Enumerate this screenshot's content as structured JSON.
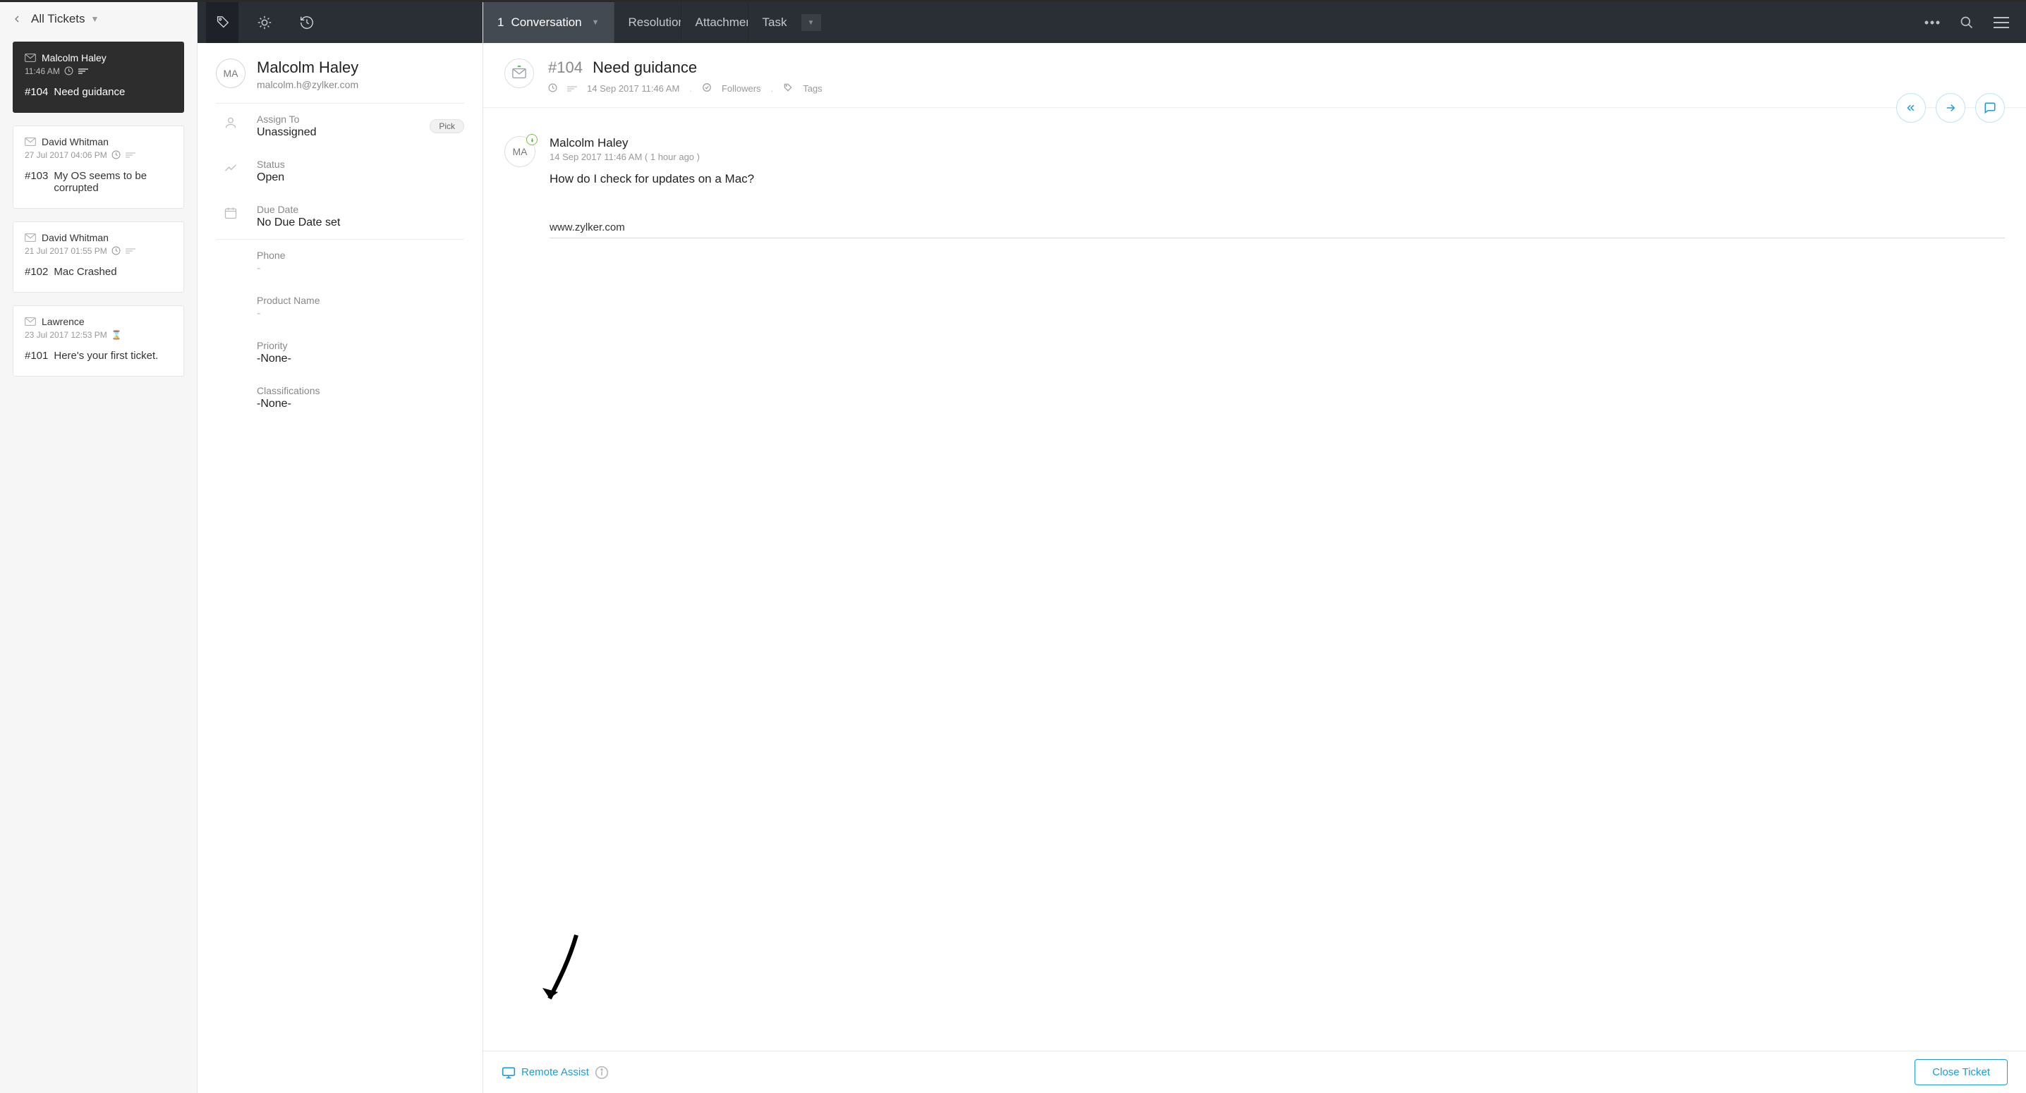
{
  "left": {
    "title": "All Tickets",
    "tickets": [
      {
        "sender": "Malcolm Haley",
        "time": "11:46 AM",
        "num": "#104",
        "title": "Need guidance"
      },
      {
        "sender": "David Whitman",
        "time": "27 Jul 2017 04:06 PM",
        "num": "#103",
        "title": "My OS seems to be corrupted"
      },
      {
        "sender": "David Whitman",
        "time": "21 Jul 2017 01:55 PM",
        "num": "#102",
        "title": "Mac Crashed"
      },
      {
        "sender": "Lawrence",
        "time": "23 Jul 2017 12:53 PM",
        "num": "#101",
        "title": "Here's your first ticket."
      }
    ]
  },
  "contact": {
    "initials": "MA",
    "name": "Malcolm Haley",
    "email": "malcolm.h@zylker.com"
  },
  "props": {
    "assign_label": "Assign To",
    "assign_value": "Unassigned",
    "pick": "Pick",
    "status_label": "Status",
    "status_value": "Open",
    "due_label": "Due Date",
    "due_value": "No Due Date set",
    "phone_label": "Phone",
    "phone_value": "-",
    "product_label": "Product Name",
    "product_value": "-",
    "priority_label": "Priority",
    "priority_value": "-None-",
    "class_label": "Classifications",
    "class_value": "-None-"
  },
  "tabs": {
    "conv_count": "1",
    "conv_label": "Conversation",
    "resolution": "Resolution",
    "attachment": "Attachment",
    "task": "Task"
  },
  "ticket": {
    "num": "#104",
    "title": "Need guidance",
    "time": "14 Sep 2017 11:46 AM",
    "followers": "Followers",
    "tags": "Tags"
  },
  "message": {
    "initials": "MA",
    "author": "Malcolm Haley",
    "time": "14 Sep 2017 11:46 AM ( 1 hour ago )",
    "body": "How do I check for updates on a Mac?",
    "link": "www.zylker.com"
  },
  "bottom": {
    "remote": "Remote Assist",
    "close": "Close Ticket"
  }
}
